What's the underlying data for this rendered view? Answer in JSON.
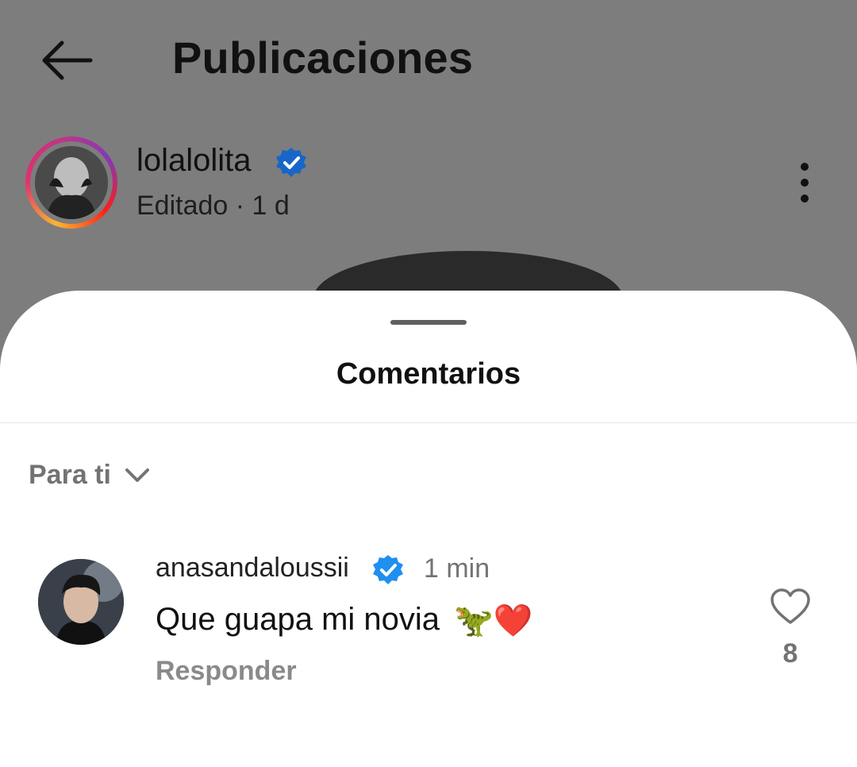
{
  "header": {
    "title": "Publicaciones",
    "back_icon": "arrow-left-icon"
  },
  "post": {
    "username": "lolalolita",
    "verified": true,
    "meta": "Editado · 1 d",
    "more_icon": "more-vertical-icon"
  },
  "sheet": {
    "title": "Comentarios",
    "sort_label": "Para ti",
    "sort_icon": "chevron-down-icon"
  },
  "comments": [
    {
      "username": "anasandaloussii",
      "verified": true,
      "time": "1 min",
      "text": "Que guapa mi novia",
      "emoji": "🦖❤️",
      "reply_label": "Responder",
      "likes": "8",
      "like_icon": "heart-outline-icon"
    }
  ],
  "colors": {
    "verified": "#1877f2",
    "dim_overlay": "#7d7d7d",
    "secondary_text": "#737373"
  }
}
